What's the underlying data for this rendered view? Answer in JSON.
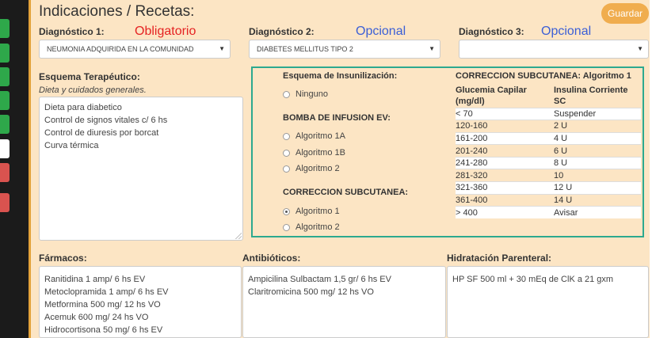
{
  "header": {
    "title": "Indicaciones / Recetas:",
    "save_label": "Guardar"
  },
  "sidebar_tabs": [
    {
      "color": "#2ea84a"
    },
    {
      "color": "#2ea84a"
    },
    {
      "color": "#2ea84a"
    },
    {
      "color": "#2ea84a"
    },
    {
      "color": "#2ea84a"
    },
    {
      "color": "#ffffff"
    },
    {
      "color": "#d9534f"
    },
    {
      "color": "#d9534f"
    }
  ],
  "diagnosticos": [
    {
      "label": "Diagnóstico 1:",
      "hint": "Obligatorio",
      "value": "NEUMONIA ADQUIRIDA EN LA COMUNIDAD"
    },
    {
      "label": "Diagnóstico 2:",
      "hint": "Opcional",
      "value": "DIABETES MELLITUS TIPO 2"
    },
    {
      "label": "Diagnóstico 3:",
      "hint": "Opcional",
      "value": ""
    }
  ],
  "esquema": {
    "label": "Esquema Terapéutico:",
    "subtitle": "Dieta y cuidados generales.",
    "lines": [
      "Dieta para diabetico",
      "Control de signos vitales c/ 6 hs",
      "Control de diuresis por borcat",
      "Curva térmica"
    ]
  },
  "insulina": {
    "title": "Esquema de Insunilización:",
    "none_label": "Ninguno",
    "bomba_title": "BOMBA DE INFUSION EV:",
    "bomba_options": [
      "Algoritmo 1A",
      "Algoritmo 1B",
      "Algoritmo 2"
    ],
    "sub_title": "CORRECCION SUBCUTANEA:",
    "sub_options": [
      "Algoritmo 1",
      "Algoritmo 2"
    ],
    "selected": "Algoritmo 1"
  },
  "correccion": {
    "title": "CORRECCION SUBCUTANEA: Algoritmo 1",
    "col1": "Glucemia Capilar (mg/dl)",
    "col2": "Insulina Corriente SC",
    "rows": [
      [
        "< 70",
        "Suspender"
      ],
      [
        "120-160",
        "2 U"
      ],
      [
        "161-200",
        "4 U"
      ],
      [
        "201-240",
        "6 U"
      ],
      [
        "241-280",
        "8 U"
      ],
      [
        "281-320",
        "10"
      ],
      [
        "321-360",
        "12 U"
      ],
      [
        "361-400",
        "14 U"
      ],
      [
        "> 400",
        "Avisar"
      ]
    ]
  },
  "farmacos": {
    "label": "Fármacos:",
    "lines": [
      "Ranitidina 1 amp/ 6 hs EV",
      "Metoclopramida 1 amp/ 6 hs EV",
      "Metformina 500 mg/ 12 hs VO",
      "Acemuk 600 mg/ 24 hs VO",
      "Hidrocortisona 50 mg/ 6 hs EV"
    ]
  },
  "antibioticos": {
    "label": "Antibióticos:",
    "lines": [
      "Ampicilina Sulbactam 1,5 gr/ 6 hs EV",
      "Claritromicina 500 mg/ 12 hs VO"
    ]
  },
  "hidratacion": {
    "label": "Hidratación Parenteral:",
    "lines": [
      "HP SF 500 ml + 30 mEq de ClK a 21 gxm"
    ]
  }
}
